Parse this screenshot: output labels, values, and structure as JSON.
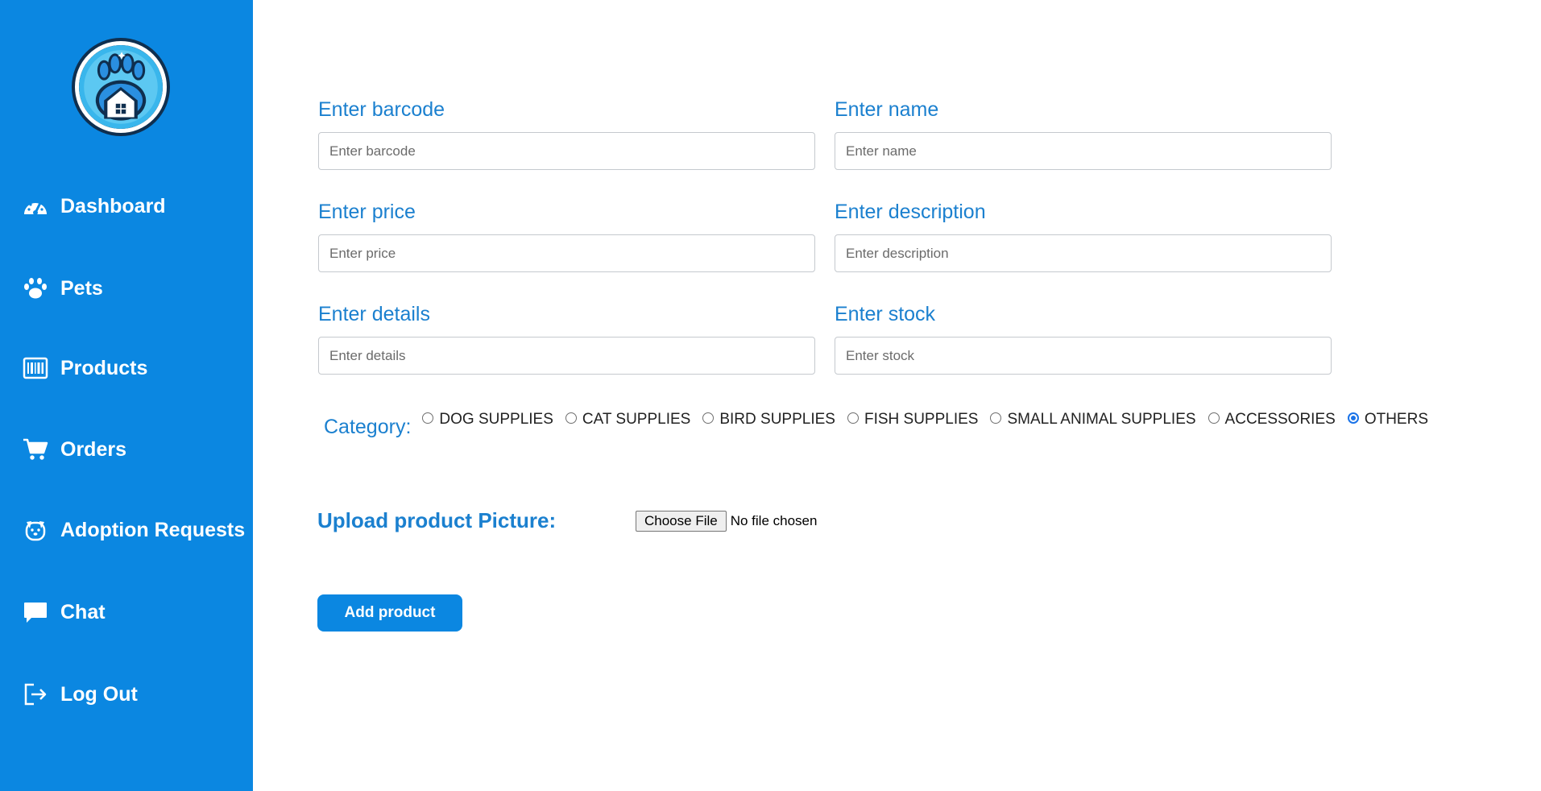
{
  "colors": {
    "sidebar_bg": "#0b87e1",
    "label_blue": "#1b80cf",
    "button_bg": "#0b87e1",
    "radio_checked": "#1a73e8"
  },
  "sidebar": {
    "logo": "paw-house-logo",
    "items": [
      {
        "label": "Dashboard",
        "icon": "gauge-icon"
      },
      {
        "label": "Pets",
        "icon": "paw-icon"
      },
      {
        "label": "Products",
        "icon": "barcode-icon"
      },
      {
        "label": "Orders",
        "icon": "cart-icon"
      },
      {
        "label": "Adoption Requests",
        "icon": "dog-face-icon"
      },
      {
        "label": "Chat",
        "icon": "chat-bubble-icon"
      },
      {
        "label": "Log Out",
        "icon": "logout-icon"
      }
    ]
  },
  "form": {
    "barcode": {
      "label": "Enter barcode",
      "placeholder": "Enter barcode",
      "value": ""
    },
    "name": {
      "label": "Enter name",
      "placeholder": "Enter name",
      "value": ""
    },
    "price": {
      "label": "Enter price",
      "placeholder": "Enter price",
      "value": ""
    },
    "description": {
      "label": "Enter description",
      "placeholder": "Enter description",
      "value": ""
    },
    "details": {
      "label": "Enter details",
      "placeholder": "Enter details",
      "value": ""
    },
    "stock": {
      "label": "Enter stock",
      "placeholder": "Enter stock",
      "value": ""
    },
    "category": {
      "label": "Category:",
      "options": [
        "DOG SUPPLIES",
        "CAT SUPPLIES",
        "BIRD SUPPLIES",
        "FISH SUPPLIES",
        "SMALL ANIMAL SUPPLIES",
        "ACCESSORIES",
        "OTHERS"
      ],
      "selected": "OTHERS"
    },
    "upload": {
      "label": "Upload product Picture:",
      "button_label": "Choose File",
      "status": "No file chosen"
    },
    "submit_label": "Add product"
  }
}
